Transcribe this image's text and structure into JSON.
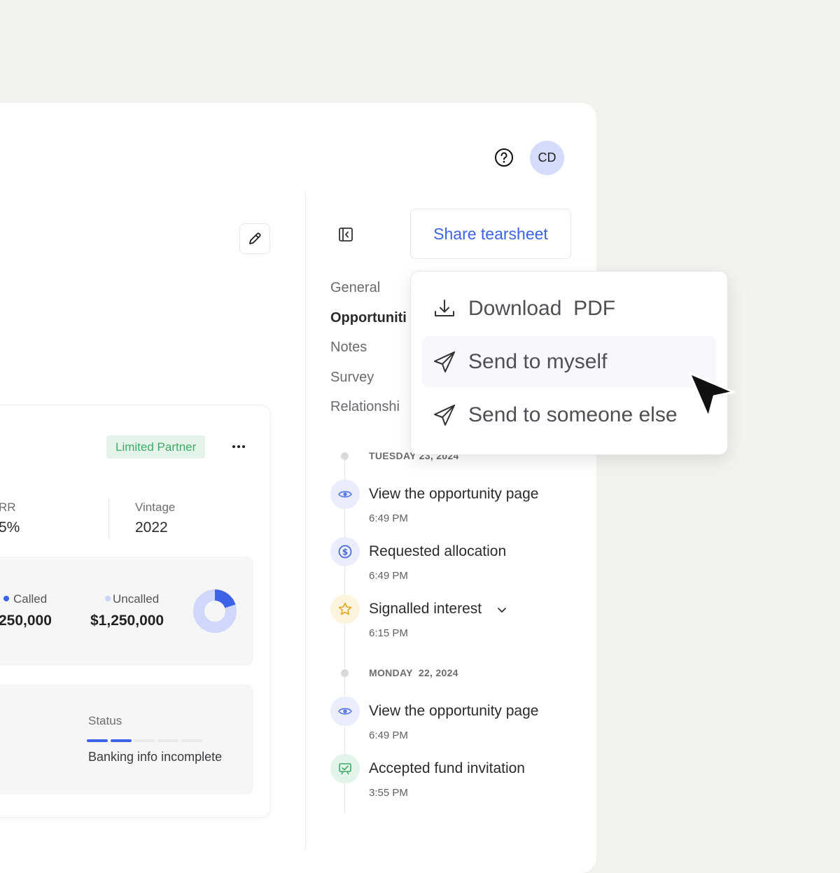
{
  "header": {
    "avatar_initials": "CD"
  },
  "card": {
    "badge": "Limited Partner",
    "stats": [
      {
        "label": "RR",
        "value": "5%"
      },
      {
        "label": "Vintage",
        "value": "2022"
      }
    ],
    "capital": {
      "called_label": "Called",
      "called_value": "250,000",
      "uncalled_label": "Uncalled",
      "uncalled_value": "$1,250,000",
      "called_fraction": 0.2
    },
    "status": {
      "label": "Status",
      "text": "Banking info incomplete",
      "steps_done": 2,
      "steps_total": 5
    }
  },
  "share_button": "Share tearsheet",
  "nav": [
    "General",
    "Opportuniti",
    "Notes",
    "Survey",
    "Relationshi"
  ],
  "menu": {
    "items": [
      "Download  PDF",
      "Send to myself",
      "Send to someone else"
    ]
  },
  "timeline": {
    "groups": [
      {
        "date": "TUESDAY 23, 2024",
        "events": [
          {
            "title": "View the opportunity page",
            "time": "6:49 PM",
            "icon": "eye-icon"
          },
          {
            "title": "Requested allocation",
            "time": "6:49 PM",
            "icon": "dollar-icon"
          },
          {
            "title": "Signalled interest",
            "time": "6:15 PM",
            "icon": "star-icon"
          }
        ]
      },
      {
        "date": "MONDAY  22, 2024",
        "events": [
          {
            "title": "View the opportunity page",
            "time": "6:49 PM",
            "icon": "eye-icon"
          },
          {
            "title": "Accepted fund invitation",
            "time": "3:55 PM",
            "icon": "invitation-icon"
          }
        ]
      }
    ]
  },
  "colors": {
    "accent": "#3c63e6",
    "badge_text": "#3faa68",
    "badge_bg": "#e4f4ea",
    "avatar_bg": "#d5dcfb"
  }
}
